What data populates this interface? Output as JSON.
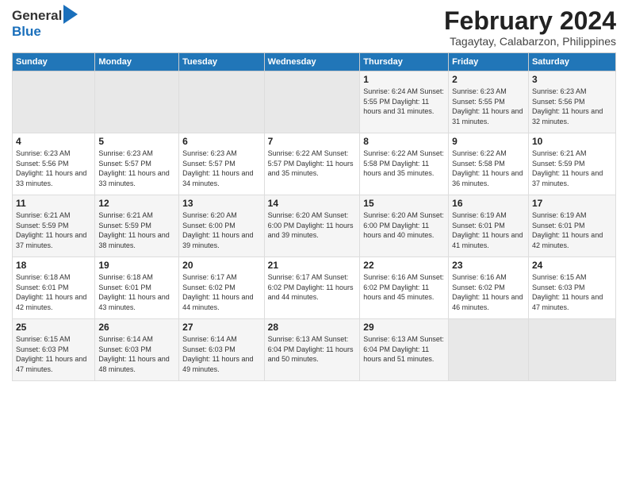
{
  "logo": {
    "line1": "General",
    "line2": "Blue"
  },
  "title": "February 2024",
  "subtitle": "Tagaytay, Calabarzon, Philippines",
  "days_header": [
    "Sunday",
    "Monday",
    "Tuesday",
    "Wednesday",
    "Thursday",
    "Friday",
    "Saturday"
  ],
  "weeks": [
    [
      {
        "num": "",
        "info": ""
      },
      {
        "num": "",
        "info": ""
      },
      {
        "num": "",
        "info": ""
      },
      {
        "num": "",
        "info": ""
      },
      {
        "num": "1",
        "info": "Sunrise: 6:24 AM\nSunset: 5:55 PM\nDaylight: 11 hours\nand 31 minutes."
      },
      {
        "num": "2",
        "info": "Sunrise: 6:23 AM\nSunset: 5:55 PM\nDaylight: 11 hours\nand 31 minutes."
      },
      {
        "num": "3",
        "info": "Sunrise: 6:23 AM\nSunset: 5:56 PM\nDaylight: 11 hours\nand 32 minutes."
      }
    ],
    [
      {
        "num": "4",
        "info": "Sunrise: 6:23 AM\nSunset: 5:56 PM\nDaylight: 11 hours\nand 33 minutes."
      },
      {
        "num": "5",
        "info": "Sunrise: 6:23 AM\nSunset: 5:57 PM\nDaylight: 11 hours\nand 33 minutes."
      },
      {
        "num": "6",
        "info": "Sunrise: 6:23 AM\nSunset: 5:57 PM\nDaylight: 11 hours\nand 34 minutes."
      },
      {
        "num": "7",
        "info": "Sunrise: 6:22 AM\nSunset: 5:57 PM\nDaylight: 11 hours\nand 35 minutes."
      },
      {
        "num": "8",
        "info": "Sunrise: 6:22 AM\nSunset: 5:58 PM\nDaylight: 11 hours\nand 35 minutes."
      },
      {
        "num": "9",
        "info": "Sunrise: 6:22 AM\nSunset: 5:58 PM\nDaylight: 11 hours\nand 36 minutes."
      },
      {
        "num": "10",
        "info": "Sunrise: 6:21 AM\nSunset: 5:59 PM\nDaylight: 11 hours\nand 37 minutes."
      }
    ],
    [
      {
        "num": "11",
        "info": "Sunrise: 6:21 AM\nSunset: 5:59 PM\nDaylight: 11 hours\nand 37 minutes."
      },
      {
        "num": "12",
        "info": "Sunrise: 6:21 AM\nSunset: 5:59 PM\nDaylight: 11 hours\nand 38 minutes."
      },
      {
        "num": "13",
        "info": "Sunrise: 6:20 AM\nSunset: 6:00 PM\nDaylight: 11 hours\nand 39 minutes."
      },
      {
        "num": "14",
        "info": "Sunrise: 6:20 AM\nSunset: 6:00 PM\nDaylight: 11 hours\nand 39 minutes."
      },
      {
        "num": "15",
        "info": "Sunrise: 6:20 AM\nSunset: 6:00 PM\nDaylight: 11 hours\nand 40 minutes."
      },
      {
        "num": "16",
        "info": "Sunrise: 6:19 AM\nSunset: 6:01 PM\nDaylight: 11 hours\nand 41 minutes."
      },
      {
        "num": "17",
        "info": "Sunrise: 6:19 AM\nSunset: 6:01 PM\nDaylight: 11 hours\nand 42 minutes."
      }
    ],
    [
      {
        "num": "18",
        "info": "Sunrise: 6:18 AM\nSunset: 6:01 PM\nDaylight: 11 hours\nand 42 minutes."
      },
      {
        "num": "19",
        "info": "Sunrise: 6:18 AM\nSunset: 6:01 PM\nDaylight: 11 hours\nand 43 minutes."
      },
      {
        "num": "20",
        "info": "Sunrise: 6:17 AM\nSunset: 6:02 PM\nDaylight: 11 hours\nand 44 minutes."
      },
      {
        "num": "21",
        "info": "Sunrise: 6:17 AM\nSunset: 6:02 PM\nDaylight: 11 hours\nand 44 minutes."
      },
      {
        "num": "22",
        "info": "Sunrise: 6:16 AM\nSunset: 6:02 PM\nDaylight: 11 hours\nand 45 minutes."
      },
      {
        "num": "23",
        "info": "Sunrise: 6:16 AM\nSunset: 6:02 PM\nDaylight: 11 hours\nand 46 minutes."
      },
      {
        "num": "24",
        "info": "Sunrise: 6:15 AM\nSunset: 6:03 PM\nDaylight: 11 hours\nand 47 minutes."
      }
    ],
    [
      {
        "num": "25",
        "info": "Sunrise: 6:15 AM\nSunset: 6:03 PM\nDaylight: 11 hours\nand 47 minutes."
      },
      {
        "num": "26",
        "info": "Sunrise: 6:14 AM\nSunset: 6:03 PM\nDaylight: 11 hours\nand 48 minutes."
      },
      {
        "num": "27",
        "info": "Sunrise: 6:14 AM\nSunset: 6:03 PM\nDaylight: 11 hours\nand 49 minutes."
      },
      {
        "num": "28",
        "info": "Sunrise: 6:13 AM\nSunset: 6:04 PM\nDaylight: 11 hours\nand 50 minutes."
      },
      {
        "num": "29",
        "info": "Sunrise: 6:13 AM\nSunset: 6:04 PM\nDaylight: 11 hours\nand 51 minutes."
      },
      {
        "num": "",
        "info": ""
      },
      {
        "num": "",
        "info": ""
      }
    ]
  ]
}
